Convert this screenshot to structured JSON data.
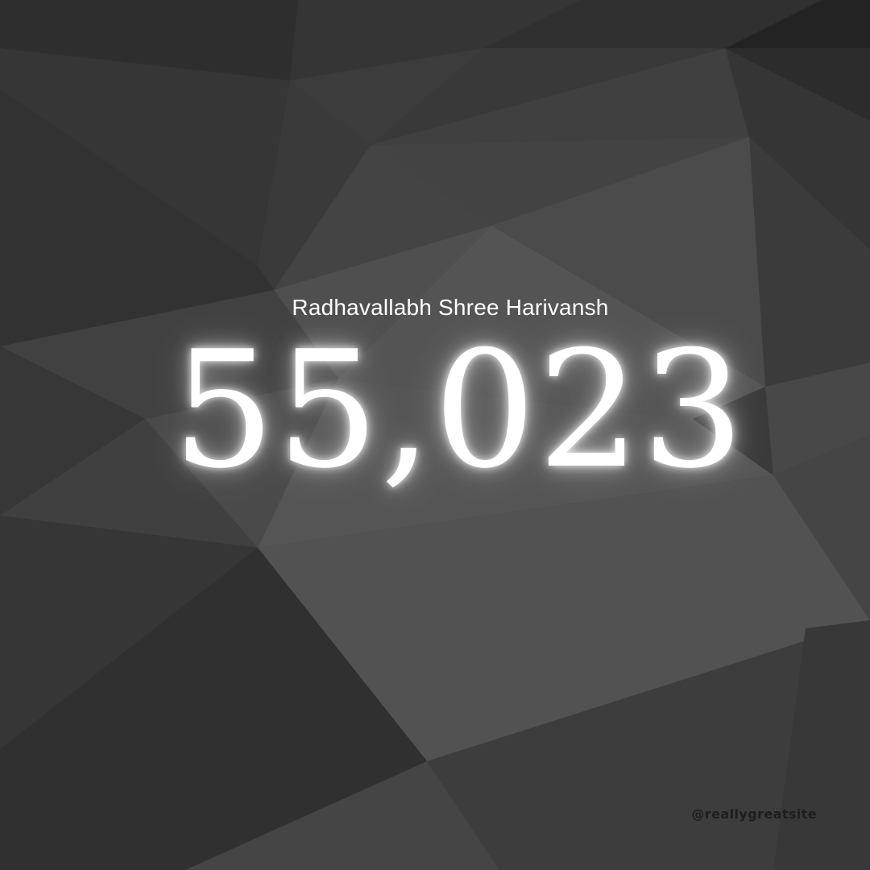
{
  "colors": {
    "background": "#3a3a3a",
    "text": "#ffffff",
    "handle_text": "#1e1e1e"
  },
  "subtitle": "Radhavallabh Shree Harivansh",
  "count": "55,023",
  "handle": "@reallygreatsite"
}
